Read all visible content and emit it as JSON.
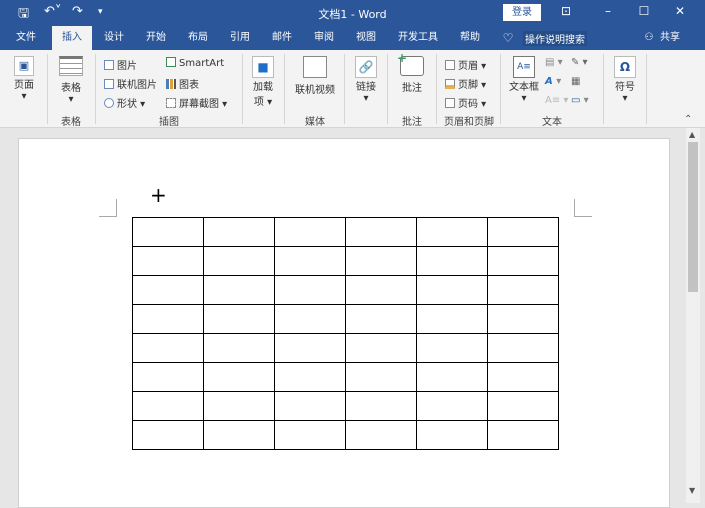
{
  "title": "文档1 - Word",
  "login": "登录",
  "tabs": [
    "文件",
    "插入",
    "设计",
    "开始",
    "布局",
    "引用",
    "邮件",
    "审阅",
    "视图",
    "开发工具",
    "帮助"
  ],
  "search": "操作说明搜索",
  "share": "共享",
  "ribbon": {
    "page": "页面",
    "table": "表格",
    "picture": "图片",
    "online_picture": "联机图片",
    "shapes": "形状",
    "smartart": "SmartArt",
    "chart": "图表",
    "screenshot": "屏幕截图",
    "addins_1": "加载",
    "addins_2": "项",
    "online_video": "联机视频",
    "link": "链接",
    "comment": "批注",
    "header": "页眉",
    "footer": "页脚",
    "page_number": "页码",
    "textbox": "文本框",
    "symbol": "符号"
  },
  "groups": {
    "table": "表格",
    "illustrations": "插图",
    "media": "媒体",
    "comments": "批注",
    "header_footer": "页眉和页脚",
    "text": "文本"
  },
  "table": {
    "rows": 8,
    "cols": 6
  }
}
